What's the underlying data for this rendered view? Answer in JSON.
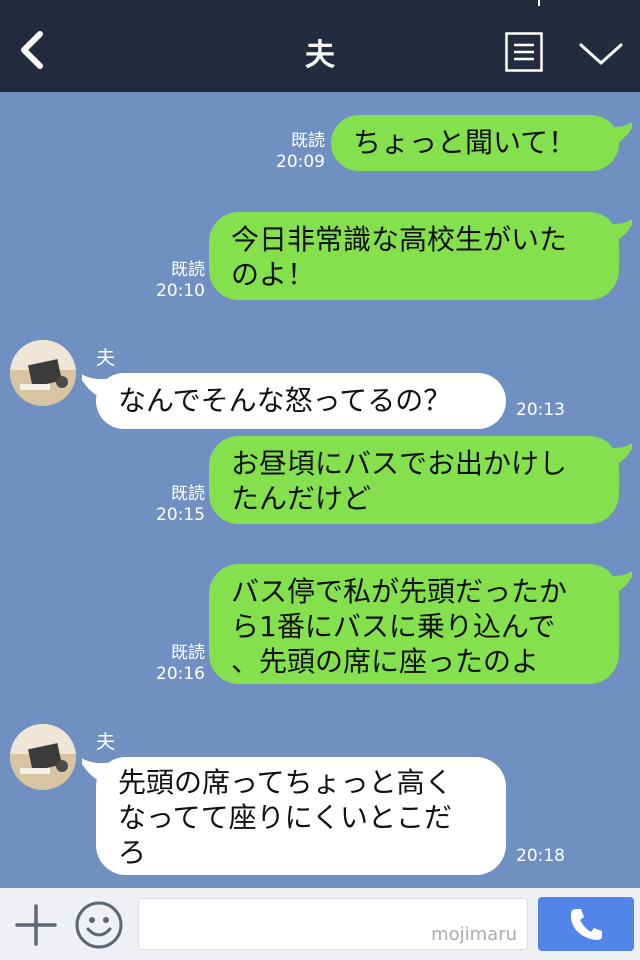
{
  "header": {
    "title": "夫"
  },
  "messages": [
    {
      "lines": [
        "ちょっと聞いて！"
      ],
      "read": "既読",
      "time": "20:09"
    },
    {
      "lines": [
        "今日非常識な高校生がいた",
        "のよ！"
      ],
      "read": "既読",
      "time": "20:10"
    },
    {
      "sender": "夫",
      "lines": [
        "なんでそんな怒ってるの？"
      ],
      "time": "20:13"
    },
    {
      "lines": [
        "お昼頃にバスでお出かけし",
        "たんだけど"
      ],
      "read": "既読",
      "time": "20:15"
    },
    {
      "lines": [
        "バス停で私が先頭だったか",
        "ら1番にバスに乗り込んで",
        "、先頭の席に座ったのよ"
      ],
      "read": "既読",
      "time": "20:16"
    },
    {
      "sender": "夫",
      "lines": [
        "先頭の席ってちょっと高く",
        "なってて座りにくいとこだ",
        "ろ"
      ],
      "time": "20:18"
    }
  ],
  "input": {
    "placeholder": "",
    "watermark": "mojimaru"
  },
  "colors": {
    "header_bg": "#232b3f",
    "chat_bg": "#7190c2",
    "sent_bubble": "#84e14d",
    "recv_bubble": "#ffffff",
    "call_button": "#5384e8"
  }
}
